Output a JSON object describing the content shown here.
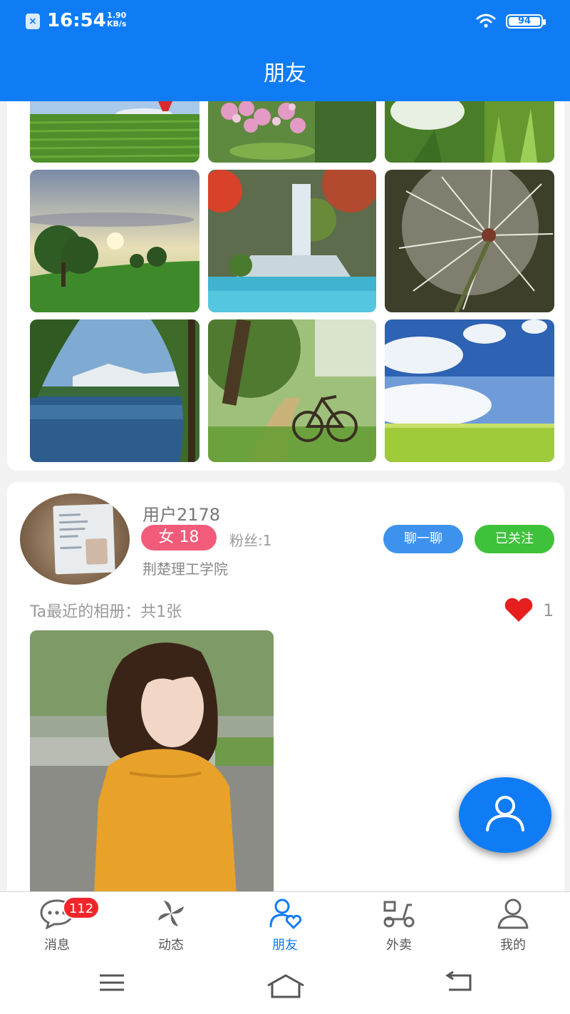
{
  "status_bar": {
    "time": "16:54",
    "speed_value": "1.90",
    "speed_unit": "KB/s",
    "battery": "94"
  },
  "header": {
    "title": "朋友"
  },
  "gallery": {
    "tiles": [
      "field-balloon",
      "pink-flowers",
      "white-tulip",
      "tree-sunset",
      "waterfall",
      "dandelion",
      "lake-mountains",
      "bicycle-path",
      "sky-meadow"
    ]
  },
  "profile": {
    "username": "用户2178",
    "gender_age": "女 18",
    "fans": "粉丝:1",
    "school": "荆楚理工学院",
    "chat_button": "聊一聊",
    "follow_button": "已关注",
    "album_label": "Ta最近的相册：共1张",
    "likes": "1"
  },
  "bottom_nav": {
    "items": [
      {
        "label": "消息",
        "icon": "chat-bubble-icon",
        "badge": "112"
      },
      {
        "label": "动态",
        "icon": "pinwheel-icon"
      },
      {
        "label": "朋友",
        "icon": "friend-heart-icon",
        "active": true
      },
      {
        "label": "外卖",
        "icon": "scooter-icon"
      },
      {
        "label": "我的",
        "icon": "person-icon"
      }
    ]
  },
  "colors": {
    "primary": "#0f7cf5",
    "gender_badge": "#f25c7a",
    "follow_green": "#3ec23b",
    "chat_blue": "#3d92ee",
    "badge_red": "#f2262a",
    "heart_red": "#e61e1e"
  }
}
